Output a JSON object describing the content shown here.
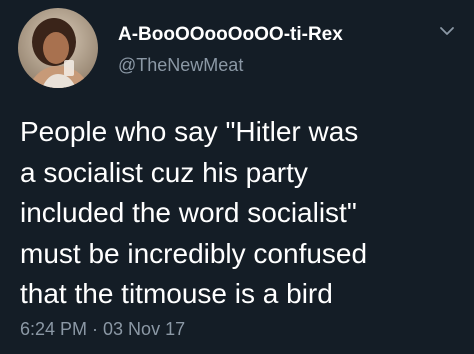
{
  "tweet": {
    "display_name": "A-BooOOooOoOO-ti-Rex",
    "handle": "@TheNewMeat",
    "text": "People who say \"Hitler was\na socialist cuz his party\nincluded the word socialist\"\nmust be incredibly confused\nthat the titmouse is a bird",
    "timestamp": "6:24 PM · 03 Nov 17"
  },
  "icons": {
    "avatar": "profile-photo",
    "menu": "chevron-down-icon"
  },
  "colors": {
    "background": "#141d26",
    "primary_text": "#ffffff",
    "secondary_text": "#8b98a5"
  }
}
